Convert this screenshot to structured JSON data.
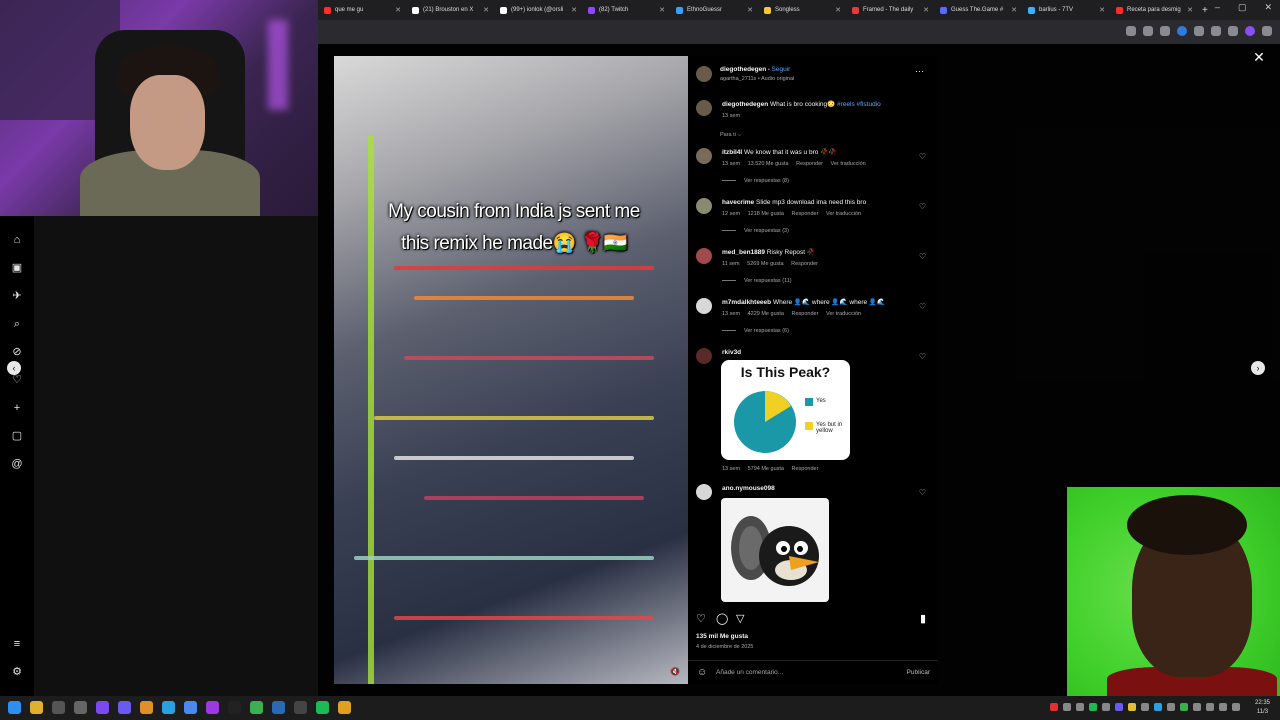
{
  "browser": {
    "tabs": [
      {
        "label": "que me gu",
        "color": "#ff2d2d"
      },
      {
        "label": "(21) Brouston en X",
        "color": "#ffffff"
      },
      {
        "label": "(99+) ionlok (@orsli",
        "color": "#ffffff"
      },
      {
        "label": "(82) Twitch",
        "color": "#9146ff"
      },
      {
        "label": "EthnoGuessr",
        "color": "#3aa0ff"
      },
      {
        "label": "Songless",
        "color": "#f5c542"
      },
      {
        "label": "Framed - The daily",
        "color": "#e23b3b"
      },
      {
        "label": "Guess The.Game #",
        "color": "#5a6cff"
      },
      {
        "label": "barlius - 7TV",
        "color": "#3ab0ff"
      },
      {
        "label": "Receta para desmig",
        "color": "#ff2d2d"
      }
    ],
    "new_tab": "+",
    "window_controls": [
      "–",
      "▢",
      "✕"
    ]
  },
  "sidebar": {
    "icons": [
      "home-icon",
      "reels-icon",
      "messages-icon",
      "search-icon",
      "explore-icon",
      "notifications-icon",
      "create-icon",
      "profile-icon",
      "threads-icon",
      "menu-icon",
      "more-icon"
    ]
  },
  "video": {
    "caption_line1": "My cousin from India js sent me",
    "caption_line2": "this remix he made😭 🌹🇮🇳",
    "mute_icon": "🔇"
  },
  "post": {
    "author": "diegothedegen",
    "follow": "Seguir",
    "separator": "•",
    "audio": "agartha_2711s • Audio original",
    "more": "⋯",
    "caption_author": "diegothedegen",
    "caption_text": "What is bro cooking😳",
    "caption_tags": "#reels #flstudio",
    "caption_time": "13 sem",
    "for_you": "Para ti ⌵",
    "likes": "135 mil Me gusta",
    "date": "4 de diciembre de 2025",
    "add_comment_placeholder": "Añade un comentario...",
    "publish": "Publicar"
  },
  "comments": [
    {
      "user": "itzbil4l",
      "text": "We know that it was u bro 🥀🥀",
      "time": "13 sem",
      "likes": "13.520 Me gusta",
      "reply": "Responder",
      "translate": "Ver traducción",
      "replies": "Ver respuestas (8)"
    },
    {
      "user": "havecrime",
      "text": "Slide mp3 download ima need this bro",
      "time": "12 sem",
      "likes": "1218 Me gusta",
      "reply": "Responder",
      "translate": "Ver traducción",
      "replies": "Ver respuestas (3)"
    },
    {
      "user": "med_ben1889",
      "text": "Risky Repost 🥀",
      "time": "11 sem",
      "likes": "5269 Me gusta",
      "reply": "Responder",
      "translate": "",
      "replies": "Ver respuestas (11)"
    },
    {
      "user": "m7mdalkhteeeb",
      "text": "Where 👤🌊 where 👤🌊 where 👤🌊",
      "time": "13 sem",
      "likes": "4229 Me gusta",
      "reply": "Responder",
      "translate": "Ver traducción",
      "replies": "Ver respuestas (6)"
    },
    {
      "user": "rkiv3d",
      "text": "",
      "time": "13 sem",
      "likes": "5794 Me gusta",
      "reply": "Responder",
      "translate": "",
      "replies": ""
    },
    {
      "user": "ano.nymouse098",
      "text": "",
      "time": "",
      "likes": "",
      "reply": "",
      "translate": "",
      "replies": ""
    }
  ],
  "pie_image": {
    "title": "Is This Peak?",
    "legend": [
      {
        "label": "Yes",
        "color": "#1a98a8"
      },
      {
        "label": "Yes but in yellow",
        "color": "#f0d022"
      }
    ]
  },
  "controls": {
    "close": "✕",
    "prev": "‹",
    "next": "›"
  },
  "taskbar": {
    "clock_time": "22:35",
    "clock_date": "11/3"
  }
}
